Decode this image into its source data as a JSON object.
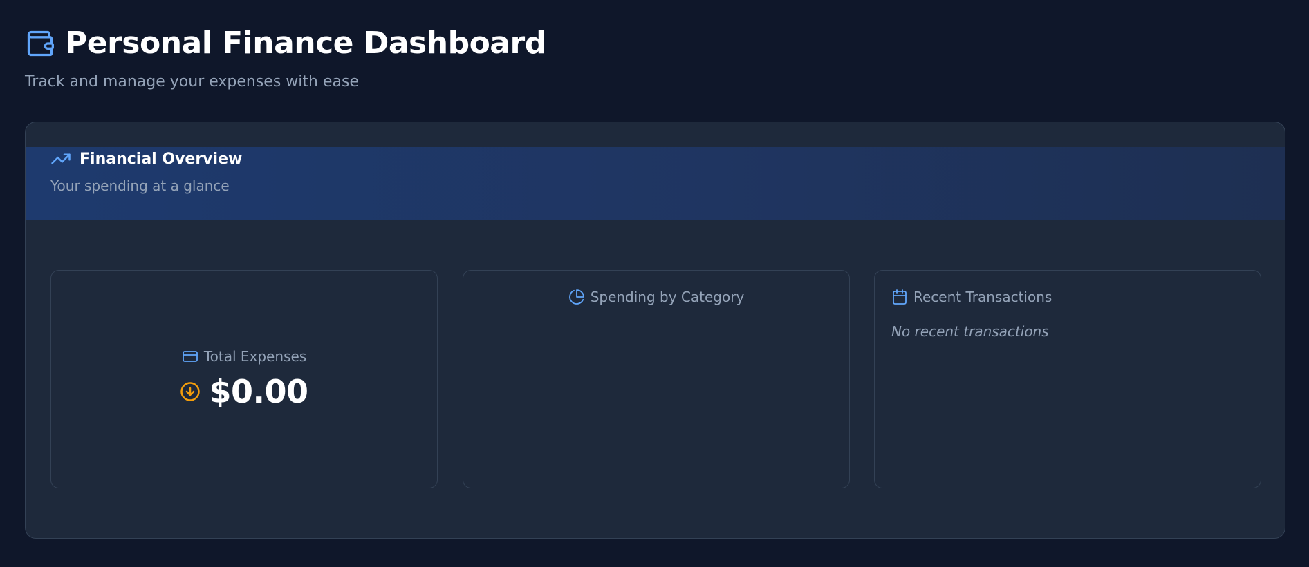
{
  "header": {
    "title": "Personal Finance Dashboard",
    "subtitle": "Track and manage your expenses with ease",
    "icon": "wallet-icon"
  },
  "overview": {
    "title": "Financial Overview",
    "subtitle": "Your spending at a glance",
    "icon": "trending-up-icon"
  },
  "panels": {
    "total": {
      "label": "Total Expenses",
      "amount": "$0.00",
      "label_icon": "credit-card-icon",
      "amount_icon": "arrow-down-circle-icon"
    },
    "category": {
      "label": "Spending by Category",
      "icon": "pie-chart-icon"
    },
    "transactions": {
      "label": "Recent Transactions",
      "empty": "No recent transactions",
      "icon": "calendar-icon"
    }
  },
  "colors": {
    "background": "#0f172a",
    "card": "#1e293b",
    "accent": "#60a5fa",
    "warning": "#f59e0b",
    "muted": "#94a3b8"
  }
}
